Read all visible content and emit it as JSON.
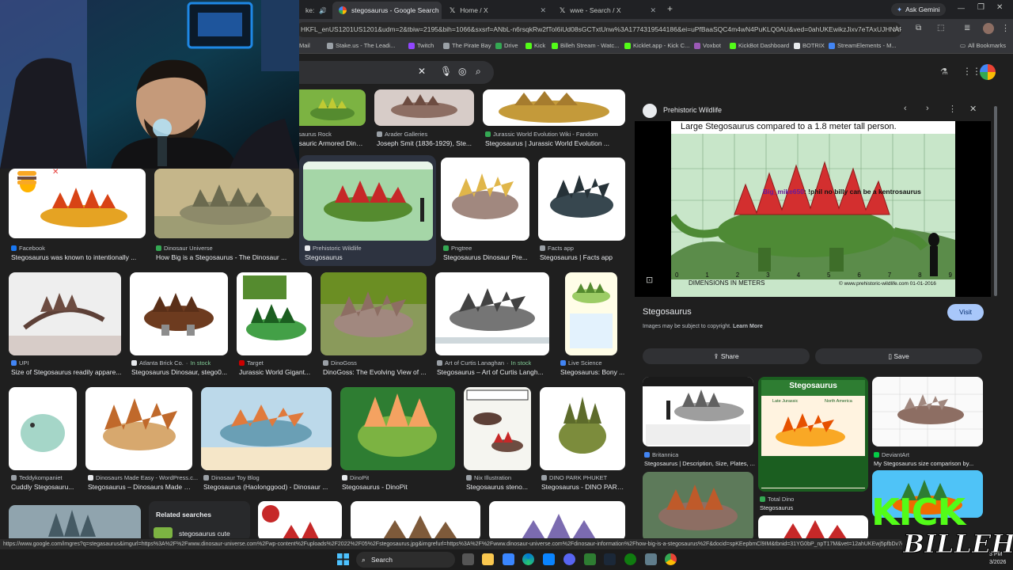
{
  "tabs": [
    {
      "label": "ke:",
      "active": false
    },
    {
      "label": "stegosaurus - Google Search",
      "active": true
    },
    {
      "label": "Home / X",
      "active": false
    },
    {
      "label": "wwe - Search / X",
      "active": false
    }
  ],
  "ask_gemini": "Ask Gemini",
  "url": "HKFL_enUS1201US1201&udm=2&tbiw=2195&bih=1066&sxsrf=ANbL-n6rsqkRw2fToI6iUd08sGCTxtUnw%3A1774319544186&ei=uPfBaaSQC4m4wN4PuKLQ0AU&ved=0ahUKEwikzJixv7eTAxUJHNAFHTgRF...",
  "bookmarks": [
    {
      "label": "Mail",
      "color": "#4285f4"
    },
    {
      "label": "Stake.us - The Leadi...",
      "color": "#9aa0a6"
    },
    {
      "label": "Twitch",
      "color": "#9146ff"
    },
    {
      "label": "The Pirate Bay",
      "color": "#9aa0a6"
    },
    {
      "label": "Drive",
      "color": "#34a853"
    },
    {
      "label": "Kick",
      "color": "#53fc18"
    },
    {
      "label": "Billeh Stream - Watc...",
      "color": "#53fc18"
    },
    {
      "label": "Kicklet.app - Kick C...",
      "color": "#53fc18"
    },
    {
      "label": "Voxbot",
      "color": "#9b59b6"
    },
    {
      "label": "KickBot Dashboard",
      "color": "#53fc18"
    },
    {
      "label": "BOTRIX",
      "color": "#e8eaed"
    },
    {
      "label": "StreamElements - M...",
      "color": "#4285f4"
    }
  ],
  "all_bookmarks": "All Bookmarks",
  "results": [
    {
      "source": "osaurus Rock",
      "caption": "osauric Armored Dino...",
      "color": "#e8eaed"
    },
    {
      "source": "Arader Galleries",
      "caption": "Joseph Smit (1836-1929), Ste...",
      "color": "#9aa0a6"
    },
    {
      "source": "Jurassic World Evolution Wiki - Fandom",
      "caption": "Stegosaurus | Jurassic World Evolution ...",
      "color": "#34a853"
    },
    {
      "source": "Facebook",
      "caption": "Stegosaurus was known to intentionally ...",
      "color": "#1877f2"
    },
    {
      "source": "Dinosaur Universe",
      "caption": "How Big is a Stegosaurus - The Dinosaur ...",
      "color": "#34a853"
    },
    {
      "source": "Prehistoric Wildlife",
      "caption": "Stegosaurus",
      "color": "#e8eaed"
    },
    {
      "source": "Pngtree",
      "caption": "Stegosaurus Dinosaur Pre...",
      "color": "#34a853"
    },
    {
      "source": "Facts app",
      "caption": "Stegosaurus | Facts app",
      "color": "#9aa0a6"
    },
    {
      "source": "UPI",
      "caption": "Size of Stegosaurus readily appare...",
      "color": "#4285f4"
    },
    {
      "source": "Atlanta Brick Co.",
      "stock": "In stock",
      "caption": "Stegosaurus Dinosaur, stego0...",
      "color": "#e8eaed"
    },
    {
      "source": "Target",
      "caption": "Jurassic World Gigant...",
      "color": "#cc0000"
    },
    {
      "source": "DinoGoss",
      "caption": "DinoGoss: The Evolving View of ...",
      "color": "#9aa0a6"
    },
    {
      "source": "Art of Curtis Lanaghan",
      "stock": "In stock",
      "caption": "Stegosaurus – Art of Curtis Langh...",
      "color": "#9aa0a6"
    },
    {
      "source": "Live Science",
      "caption": "Stegosaurus: Bony ...",
      "color": "#4285f4"
    },
    {
      "source": "Teddykompaniet",
      "caption": "Cuddly Stegosauru...",
      "color": "#9aa0a6"
    },
    {
      "source": "Dinosaurs Made Easy - WordPress.c...",
      "caption": "Stegosaurus – Dinosaurs Made E...",
      "color": "#e8eaed"
    },
    {
      "source": "Dinosaur Toy Blog",
      "caption": "Stegosaurus (Haolonggood) - Dinosaur ...",
      "color": "#9aa0a6"
    },
    {
      "source": "DinoPit",
      "caption": "Stegosaurus - DinoPit",
      "color": "#e8eaed"
    },
    {
      "source": "Nix Illustration",
      "caption": "Stegosaurus steno...",
      "color": "#9aa0a6"
    },
    {
      "source": "DINO PARK PHUKET",
      "caption": "Stegosaurus - DINO PARK...",
      "color": "#9aa0a6"
    }
  ],
  "related_searches": {
    "title": "Related searches",
    "item": "stegosaurus cute"
  },
  "panel": {
    "site": "Prehistoric Wildlife",
    "image_caption": "Large Stegosaurus compared to a 1.8 meter tall person.",
    "dimensions_label": "DIMENSIONS IN METERS",
    "copyright": "© www.prehistoric-wildlife.com 01-01-2016",
    "ticks": [
      "0",
      "1",
      "2",
      "3",
      "4",
      "5",
      "6",
      "7",
      "8",
      "9"
    ],
    "title": "Stegosaurus",
    "visit": "Visit",
    "copyright_note": "Images may be subject to copyright.",
    "learn_more": "Learn More",
    "share": "Share",
    "save": "Save",
    "chat_user": "Big_mike650",
    "chat_msg": ": !phil no billy can be a kentrosaurus",
    "related": [
      {
        "source": "Britannica",
        "caption": "Stegosaurus | Description, Size, Plates, ..."
      },
      {
        "source": "DeviantArt",
        "caption": "My Stegosaurus size comparison by..."
      },
      {
        "source": "Total Dino",
        "caption": "Stegosaurus"
      }
    ],
    "card_title": "Stegosaurus",
    "card_sub1": "Late Jurassic",
    "card_sub2": "North America"
  },
  "status_url": "https://www.google.com/imgres?q=stegasaurus&imgurl=https%3A%2F%2Fwww.dinosaur-universe.com%2Fwp-content%2Fuploads%2F2022%2F05%2Fstegosaurus.jpg&imgrefurl=https%3A%2F%2Fwww.dinosaur-universe.com%2Fdinosaur-information%2Fhow-big-is-a-stegosaurus%2F&docid=spKEepbmCl9IM&tbnid=31YG0bP_npT17M&vet=12ahUKEwj5pfbDv7eTAxUPI",
  "taskbar": {
    "search": "Search",
    "clock": "3 PM",
    "date": "3/2026"
  },
  "kick_logo": {
    "top": "KICK",
    "bottom": "BILLEH"
  }
}
